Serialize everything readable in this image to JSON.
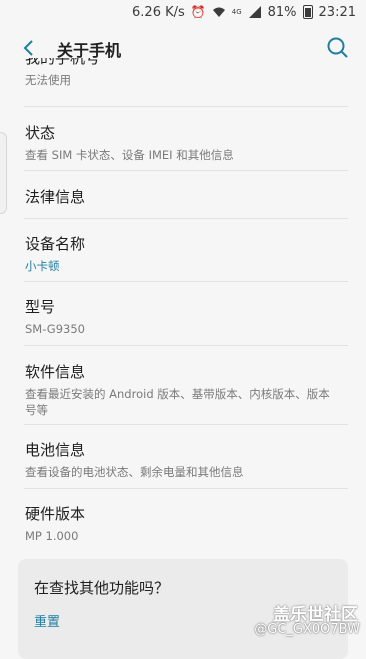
{
  "status_bar": {
    "speed": "6.26 K/s",
    "network": "4G",
    "battery": "81%",
    "time": "23:21"
  },
  "app_bar": {
    "title": "关于手机"
  },
  "partial_row": {
    "title": "我的手机号",
    "subtitle": "无法使用"
  },
  "items": [
    {
      "title": "状态",
      "subtitle": "查看 SIM 卡状态、设备 IMEI 和其他信息"
    },
    {
      "title": "法律信息"
    },
    {
      "title": "设备名称",
      "subtitle": "小卡顿"
    },
    {
      "title": "型号",
      "subtitle": "SM-G9350"
    },
    {
      "title": "软件信息",
      "subtitle": "查看最近安装的 Android 版本、基带版本、内核版本、版本号等"
    },
    {
      "title": "电池信息",
      "subtitle": "查看设备的电池状态、剩余电量和其他信息"
    },
    {
      "title": "硬件版本",
      "subtitle": "MP 1.000"
    }
  ],
  "suggestion": {
    "title": "在查找其他功能吗？",
    "link": "重置"
  },
  "watermark": {
    "line1": "盖乐世社区",
    "line2": "@GC_GX0O7BW"
  },
  "colors": {
    "accent": "#1f7e9f",
    "background": "#f6f6f6"
  }
}
